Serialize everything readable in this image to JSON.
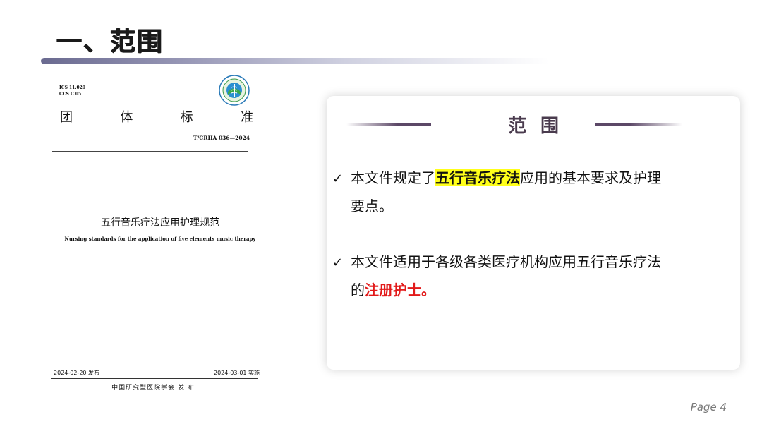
{
  "title": "一、范围",
  "document": {
    "ics_line1": "ICS 11.020",
    "ics_line2": "CCS C 05",
    "type_chars": [
      "团",
      "体",
      "标",
      "准"
    ],
    "code": "T/CRHA 036—2024",
    "name_cn": "五行音乐疗法应用护理规范",
    "name_en": "Nursing standards for the application of five elements music therapy",
    "publish_date": "2024-02-20 发布",
    "implement_date": "2024-03-01 实施",
    "publisher": "中国研究型医院学会  发  布"
  },
  "card": {
    "title": "范围",
    "items": [
      {
        "check": "✓",
        "pre": "本文件规定了",
        "highlight": "五行音乐疗法",
        "post": "应用的基本要求及护理",
        "line2": "要点。"
      },
      {
        "check": "✓",
        "line1": "本文件适用于各级各类医疗机构应用五行音乐疗法",
        "pre2": "的",
        "red": "注册护士。"
      }
    ]
  },
  "page_label": "Page 4",
  "colors": {
    "highlight": "#ffff1a",
    "emphasis_red": "#e21a1a",
    "card_title": "#4a3b4e",
    "title_bar": "#6a6a90"
  }
}
